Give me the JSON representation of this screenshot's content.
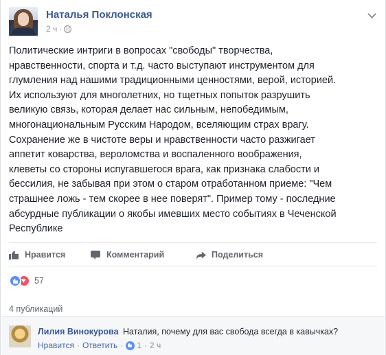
{
  "post": {
    "author": "Наталья Поклонская",
    "time": "2 ч",
    "separator": "·",
    "text": "Политические интриги в вопросах \"свободы\" творчества,\nнравственности, спорта и т.д. часто выступают инструментом для\nглумления над нашими традиционными ценностями, верой, историей.\nИх используют для многолетних, но тщетных попыток разрушить\nвеликую связь, которая делает нас сильным, непобедимым,\nмногонациональным Русским Народом, вселяющим страх врагу.\nСохранение же в чистоте веры и нравственности часто разжигает\nаппетит коварства, вероломства и воспаленного воображения,\nклеветы со стороны испугавшегося врага, как признака слабости и\nбессилия, не забывая при этом о старом отработанном приеме: \"Чем\nстрашнее ложь - тем скорее в нее поверят\". Пример тому - последние\nабсурдные публикации о якобы имевших место событиях в Чеченской\nРеспублике"
  },
  "actions": {
    "like": "Нравится",
    "comment": "Комментарий",
    "share": "Поделиться"
  },
  "reactions": {
    "count": "57",
    "icons": [
      "like-icon",
      "love-icon"
    ],
    "like_color": "#5890ff",
    "love_color": "#f25268"
  },
  "shares": "4 публикаций",
  "comment": {
    "author": "Лилия Винокурова",
    "text": "Наталия, почему для вас свобода всегда в кавычках?",
    "like": "Нравится",
    "reply": "Ответить",
    "likes": "1",
    "time": "2 ч",
    "sep": "·"
  },
  "colors": {
    "link": "#365899",
    "secondary": "#90949c",
    "action": "#606770"
  }
}
